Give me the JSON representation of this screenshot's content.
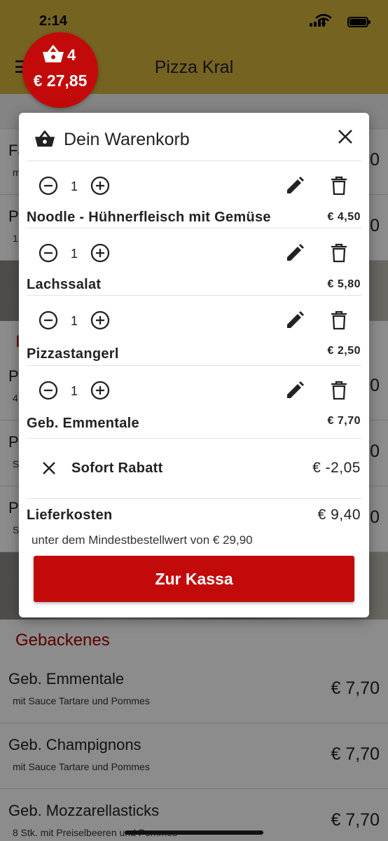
{
  "status": {
    "time": "2:14"
  },
  "app": {
    "title": "Pizza Kral"
  },
  "cart_badge": {
    "count": "4",
    "total": "€ 27,85"
  },
  "background": {
    "rows_top": [
      {
        "name": "Fa",
        "desc": "m",
        "price": "0"
      },
      {
        "name": "P",
        "desc": "1",
        "price": "0"
      }
    ],
    "section_red": "I",
    "rows_mid": [
      {
        "name": "P",
        "desc": "4",
        "price": "0"
      },
      {
        "name": "P",
        "desc": "S",
        "price": "0"
      },
      {
        "name": "P",
        "desc": "S",
        "price": "0"
      }
    ],
    "section": "Gebackenes",
    "rows_bottom": [
      {
        "name": "Geb. Emmentale",
        "desc": "mit Sauce Tartare und Pommes",
        "price": "€ 7,70"
      },
      {
        "name": "Geb. Champignons",
        "desc": "mit Sauce Tartare und Pommes",
        "price": "€ 7,70"
      },
      {
        "name": "Geb. Mozzarellasticks",
        "desc": "8 Stk. mit Preiselbeeren und Pommes",
        "price": "€ 7,70"
      }
    ]
  },
  "cart": {
    "title": "Dein Warenkorb",
    "items": [
      {
        "qty": "1",
        "name": "Noodle - Hühnerfleisch mit Gemüse",
        "price": "€ 4,50"
      },
      {
        "qty": "1",
        "name": "Lachssalat",
        "price": "€ 5,80"
      },
      {
        "qty": "1",
        "name": "Pizzastangerl",
        "price": "€ 2,50"
      },
      {
        "qty": "1",
        "name": "Geb. Emmentale",
        "price": "€ 7,70"
      }
    ],
    "discount": {
      "label": "Sofort Rabatt",
      "value": "€ -2,05"
    },
    "delivery": {
      "label": "Lieferkosten",
      "value": "€ 9,40",
      "note": "unter dem Mindestbestellwert von € 29,90"
    },
    "checkout_label": "Zur Kassa"
  },
  "colors": {
    "appbar": "#d6b53c",
    "brand_red": "#c30a0a",
    "section_red": "#a30000"
  },
  "icons": [
    "menu-icon",
    "basket-icon",
    "close-icon",
    "minus-circle-icon",
    "plus-circle-icon",
    "pencil-icon",
    "trash-icon",
    "wifi-icon",
    "battery-icon"
  ]
}
